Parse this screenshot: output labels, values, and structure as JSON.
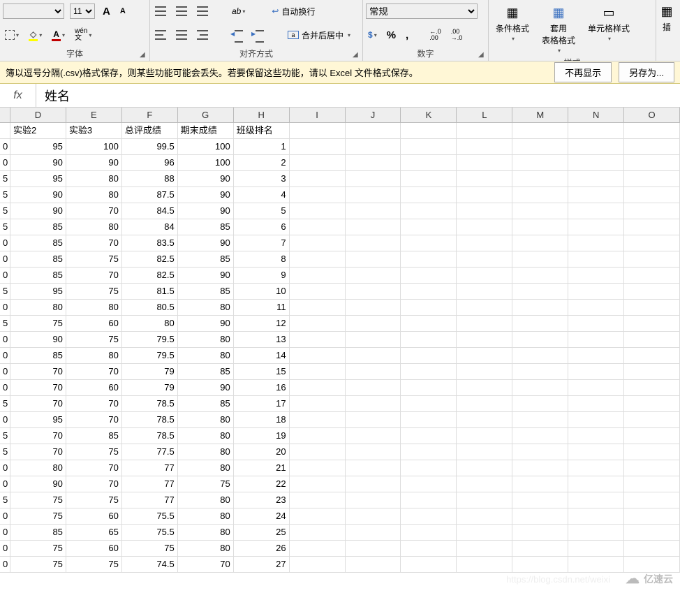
{
  "ribbon": {
    "font": {
      "name": "",
      "size": "11",
      "increase_aria": "A",
      "decrease_aria": "A",
      "borders_aria": "边框",
      "fill_color": "#ffff00",
      "font_color": "#c00000",
      "phonetic_aria": "拼音",
      "label": "字体"
    },
    "align": {
      "wrap_label": "自动换行",
      "merge_label": "合并后居中",
      "label": "对齐方式"
    },
    "number": {
      "format": "常规",
      "label": "数字"
    },
    "styles": {
      "cond_label": "条件格式",
      "table_label": "套用\n表格格式",
      "cell_label": "单元格样式",
      "label": "样式"
    },
    "insert": "插"
  },
  "notify": {
    "text": "簿以逗号分隔(.csv)格式保存，则某些功能可能会丢失。若要保留这些功能，请以 Excel 文件格式保存。",
    "dismiss": "不再显示",
    "saveas": "另存为..."
  },
  "formula": "姓名",
  "columns": [
    "D",
    "E",
    "F",
    "G",
    "H",
    "I",
    "J",
    "K",
    "L",
    "M",
    "N",
    "O"
  ],
  "col_widths": [
    "wD",
    "wE",
    "wF",
    "wG",
    "wH",
    "wI",
    "wJ",
    "wK",
    "wL",
    "wM",
    "wN",
    "wO"
  ],
  "headers": [
    "实验2",
    "实验3",
    "总评成绩",
    "期末成绩",
    "班级排名"
  ],
  "rows": [
    [
      95,
      100,
      99.5,
      100,
      1
    ],
    [
      90,
      90,
      96,
      100,
      2
    ],
    [
      95,
      80,
      88,
      90,
      3
    ],
    [
      90,
      80,
      87.5,
      90,
      4
    ],
    [
      90,
      70,
      84.5,
      90,
      5
    ],
    [
      85,
      80,
      84,
      85,
      6
    ],
    [
      85,
      70,
      83.5,
      90,
      7
    ],
    [
      85,
      75,
      82.5,
      85,
      8
    ],
    [
      85,
      70,
      82.5,
      90,
      9
    ],
    [
      95,
      75,
      81.5,
      85,
      10
    ],
    [
      80,
      80,
      80.5,
      80,
      11
    ],
    [
      75,
      60,
      80,
      90,
      12
    ],
    [
      90,
      75,
      79.5,
      80,
      13
    ],
    [
      85,
      80,
      79.5,
      80,
      14
    ],
    [
      70,
      70,
      79,
      85,
      15
    ],
    [
      70,
      60,
      79,
      90,
      16
    ],
    [
      70,
      70,
      78.5,
      85,
      17
    ],
    [
      95,
      70,
      78.5,
      80,
      18
    ],
    [
      70,
      85,
      78.5,
      80,
      19
    ],
    [
      70,
      75,
      77.5,
      80,
      20
    ],
    [
      80,
      70,
      77,
      80,
      21
    ],
    [
      90,
      70,
      77,
      75,
      22
    ],
    [
      75,
      75,
      77,
      80,
      23
    ],
    [
      75,
      60,
      75.5,
      80,
      24
    ],
    [
      85,
      65,
      75.5,
      80,
      25
    ],
    [
      75,
      60,
      75,
      80,
      26
    ],
    [
      75,
      75,
      74.5,
      70,
      27
    ]
  ],
  "stub_col": [
    "0",
    "0",
    "5",
    "5",
    "5",
    "5",
    "0",
    "0",
    "0",
    "5",
    "0",
    "5",
    "0",
    "0",
    "0",
    "0",
    "5",
    "0",
    "5",
    "5",
    "0",
    "0",
    "5",
    "0",
    "0",
    "0",
    "0"
  ],
  "watermark": {
    "text": "亿速云",
    "url": "https://blog.csdn.net/weixi"
  }
}
